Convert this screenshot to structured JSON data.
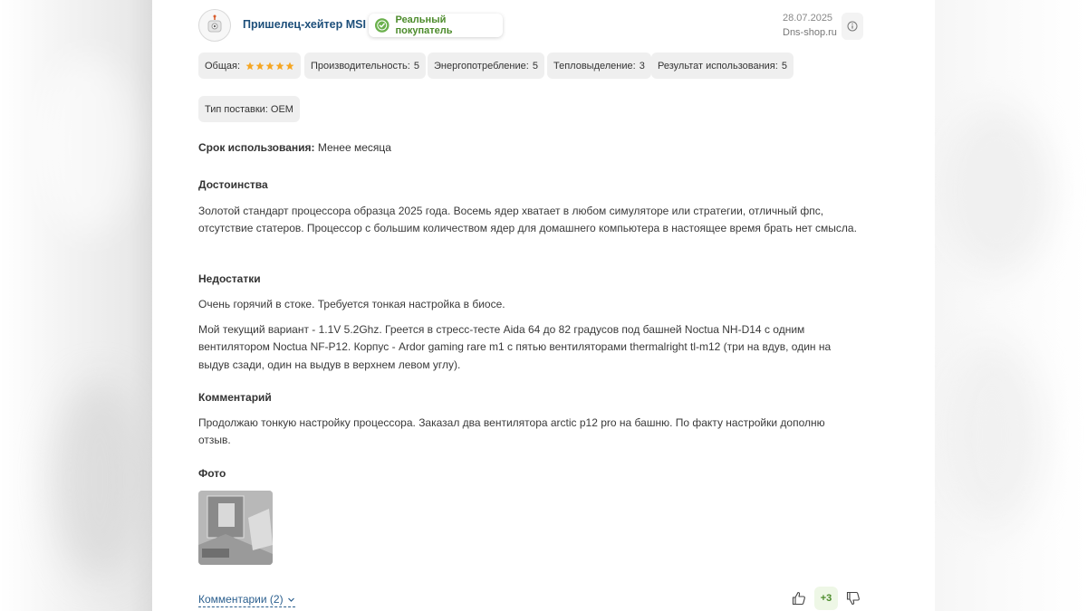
{
  "review": {
    "author": "Пришелец-хейтер MSI",
    "badge": "Реальный покупатель",
    "date": "28.07.2025",
    "source": "Dns-shop.ru",
    "ratings": {
      "overall_label": "Общая:",
      "overall_stars": 5,
      "items": [
        {
          "label": "Производительность:",
          "value": "5"
        },
        {
          "label": "Энергопотребление:",
          "value": "5"
        },
        {
          "label": "Тепловыделение:",
          "value": "3"
        },
        {
          "label": "Результат использования:",
          "value": "5"
        }
      ]
    },
    "delivery_chip": "Тип поставки: OEM",
    "usage": {
      "label": "Срок использования:",
      "value": "Менее месяца"
    },
    "pros": {
      "title": "Достоинства",
      "text": "Золотой стандарт процессора образца 2025 года. Восемь ядер хватает в любом симуляторе или стратегии, отличный фпс, отсутствие статеров. Процессор с большим количеством ядер для домашнего компьютера в настоящее время брать нет смысла."
    },
    "cons": {
      "title": "Недостатки",
      "text1": "Очень горячий в стоке. Требуется тонкая настройка в биосе.",
      "text2": "Мой текущий вариант - 1.1V 5.2Ghz. Греется в стресс-тесте Aida 64 до 82 градусов под башней Noctua NH-D14 с одним вентилятором Noctua NF-P12. Корпус - Ardor gaming rare m1 с пятью вентиляторами thermalright tl-m12 (три на вдув, один на выдув сзади, один на выдув в верхнем левом углу)."
    },
    "comment": {
      "title": "Комментарий",
      "text": "Продолжаю тонкую настройку процессора. Заказал два вентилятора arctic p12 pro на башню. По факту настройки дополню отзыв."
    },
    "photo_title": "Фото",
    "comments_link": "Комментарии (2)",
    "votes": "+3"
  },
  "colors": {
    "author": "#1d4f7a",
    "badge_green": "#4c8b2b",
    "star": "#f5a623",
    "chip_bg": "#efefef",
    "link": "#2b5f8e"
  },
  "icons": {
    "avatar": "robot-avatar-icon",
    "badge": "verified-gear-icon",
    "info": "info-circle-icon",
    "like": "thumbs-up-icon",
    "dislike": "thumbs-down-icon",
    "chevron": "chevron-down-icon"
  }
}
